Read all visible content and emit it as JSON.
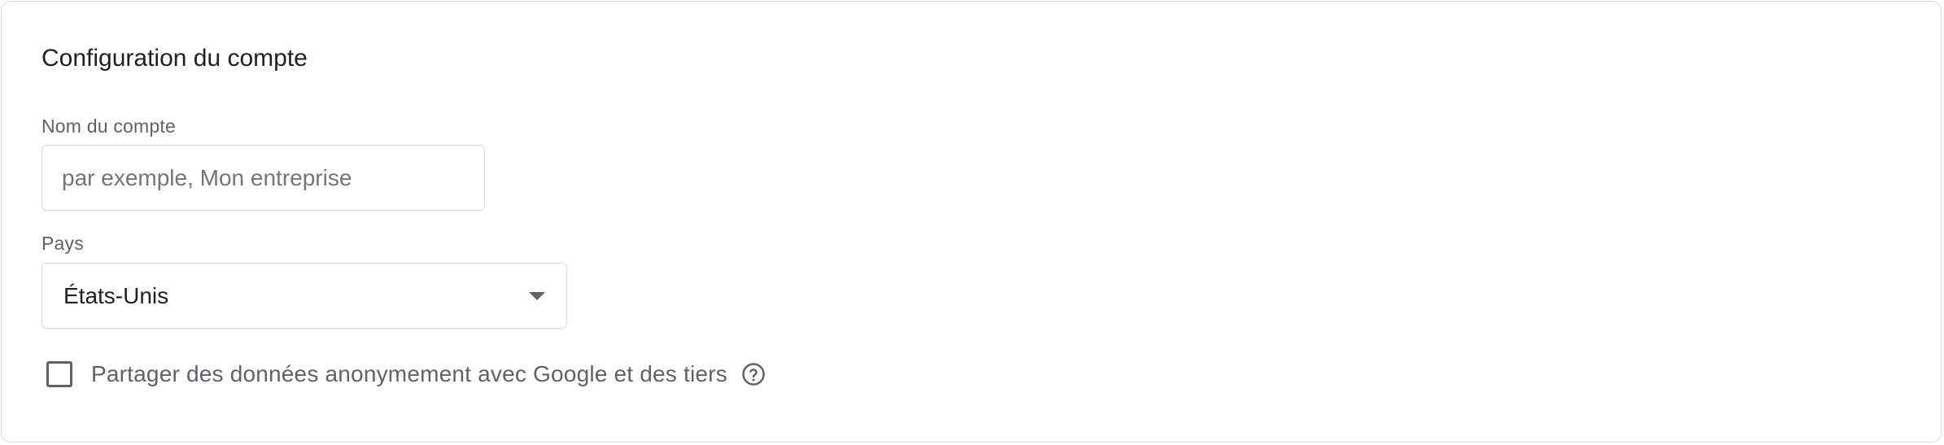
{
  "section": {
    "title": "Configuration du compte"
  },
  "account_name": {
    "label": "Nom du compte",
    "placeholder": "par exemple, Mon entreprise",
    "value": ""
  },
  "country": {
    "label": "Pays",
    "selected": "États-Unis"
  },
  "share_data": {
    "label": "Partager des données anonymement avec Google et des tiers",
    "checked": false,
    "help_icon": "help-circle-outline"
  },
  "colors": {
    "border": "#dadce0",
    "text_primary": "#202124",
    "text_secondary": "#5f6368"
  }
}
